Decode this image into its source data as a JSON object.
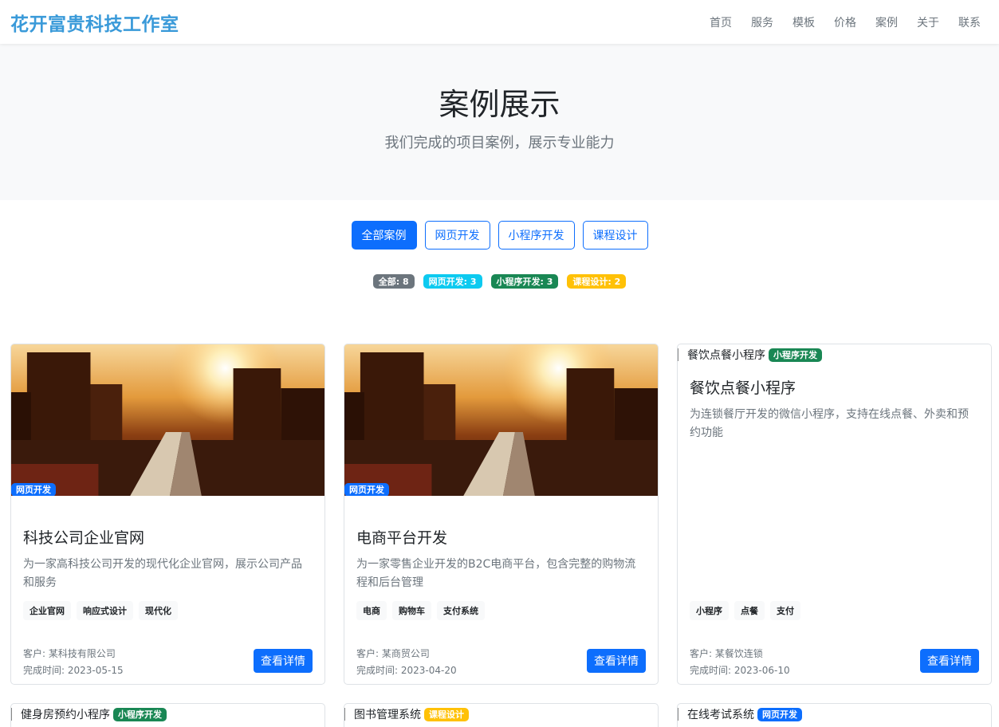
{
  "brand": "花开富贵科技工作室",
  "nav": [
    "首页",
    "服务",
    "模板",
    "价格",
    "案例",
    "关于",
    "联系"
  ],
  "hero": {
    "title": "案例展示",
    "subtitle": "我们完成的项目案例，展示专业能力"
  },
  "filters": [
    "全部案例",
    "网页开发",
    "小程序开发",
    "课程设计"
  ],
  "counts": [
    {
      "label": "全部: 8",
      "color": "#6c757d"
    },
    {
      "label": "网页开发: 3",
      "color": "#0dcaf0"
    },
    {
      "label": "小程序开发: 3",
      "color": "#198754"
    },
    {
      "label": "课程设计: 2",
      "color": "#ffc107"
    }
  ],
  "detail_label": "查看详情",
  "cards": [
    {
      "category": "网页开发",
      "title": "科技公司企业官网",
      "description": "为一家高科技公司开发的现代化企业官网，展示公司产品和服务",
      "tags": [
        "企业官网",
        "响应式设计",
        "现代化"
      ],
      "client": "客户: 某科技有限公司",
      "date": "完成时间: 2023-05-15"
    },
    {
      "category": "网页开发",
      "title": "电商平台开发",
      "description": "为一家零售企业开发的B2C电商平台，包含完整的购物流程和后台管理",
      "tags": [
        "电商",
        "购物车",
        "支付系统"
      ],
      "client": "客户: 某商贸公司",
      "date": "完成时间: 2023-04-20"
    },
    {
      "image_alt": "餐饮点餐小程序",
      "category": "小程序开发",
      "title": "餐饮点餐小程序",
      "description": "为连锁餐厅开发的微信小程序，支持在线点餐、外卖和预约功能",
      "tags": [
        "小程序",
        "点餐",
        "支付"
      ],
      "client": "客户: 某餐饮连锁",
      "date": "完成时间: 2023-06-10"
    },
    {
      "image_alt": "健身房预约小程序",
      "category": "小程序开发"
    },
    {
      "image_alt": "图书管理系统",
      "category": "课程设计"
    },
    {
      "image_alt": "在线考试系统",
      "category": "网页开发"
    }
  ]
}
